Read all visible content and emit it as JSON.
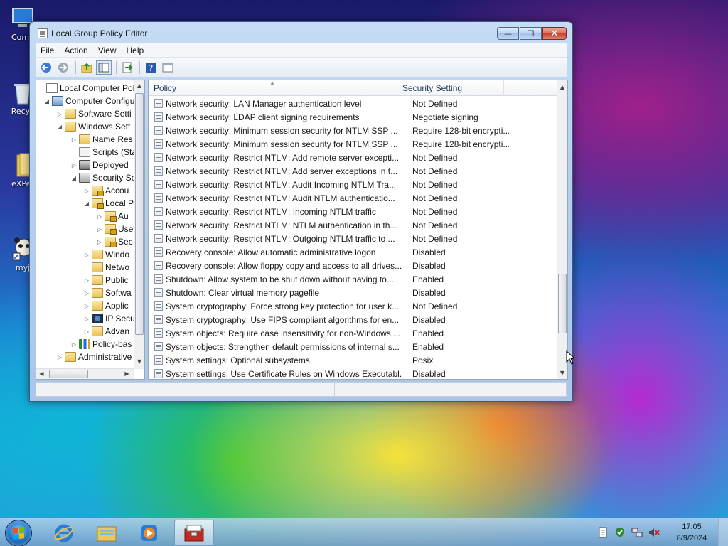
{
  "desktop": {
    "icons": [
      {
        "label": "Comp"
      },
      {
        "label": "Recyc"
      },
      {
        "label": "eXPer"
      },
      {
        "label": "myj"
      }
    ]
  },
  "window": {
    "title": "Local Group Policy Editor",
    "caption_buttons": {
      "minimize": "—",
      "maximize": "❐",
      "close": "✕"
    },
    "menu": [
      {
        "label": "File"
      },
      {
        "label": "Action"
      },
      {
        "label": "View"
      },
      {
        "label": "Help"
      }
    ],
    "toolbar": [
      "back-icon",
      "forward-icon",
      "up-folder-icon",
      "show-hide-tree-icon",
      "export-list-icon",
      "help-icon",
      "properties-icon"
    ],
    "tree": [
      {
        "label": "Local Computer Polic",
        "exp": "",
        "icon": "policy"
      },
      {
        "label": "Computer Configu",
        "exp": "◢",
        "icon": "computer"
      },
      {
        "label": "Software Setti",
        "exp": "▷",
        "icon": "folder"
      },
      {
        "label": "Windows Sett",
        "exp": "◢",
        "icon": "folder"
      },
      {
        "label": "Name Res",
        "exp": "▷",
        "icon": "folder"
      },
      {
        "label": "Scripts (Sta",
        "exp": "",
        "icon": "scripts"
      },
      {
        "label": "Deployed",
        "exp": "▷",
        "icon": "printer"
      },
      {
        "label": "Security Se",
        "exp": "◢",
        "icon": "security"
      },
      {
        "label": "Accou",
        "exp": "▷",
        "icon": "lockfolder"
      },
      {
        "label": "Local P",
        "exp": "◢",
        "icon": "lockfolder"
      },
      {
        "label": "Au",
        "exp": "▷",
        "icon": "lockfolder"
      },
      {
        "label": "Use",
        "exp": "▷",
        "icon": "lockfolder"
      },
      {
        "label": "Sec",
        "exp": "▷",
        "icon": "lockfolder"
      },
      {
        "label": "Windo",
        "exp": "▷",
        "icon": "folder"
      },
      {
        "label": "Netwo",
        "exp": "",
        "icon": "folder"
      },
      {
        "label": "Public",
        "exp": "▷",
        "icon": "folder"
      },
      {
        "label": "Softwa",
        "exp": "▷",
        "icon": "folder"
      },
      {
        "label": "Applic",
        "exp": "▷",
        "icon": "folder"
      },
      {
        "label": "IP Secu",
        "exp": "▷",
        "icon": "ipsec"
      },
      {
        "label": "Advan",
        "exp": "▷",
        "icon": "folder"
      },
      {
        "label": "Policy-bas",
        "exp": "▷",
        "icon": "chart"
      },
      {
        "label": "Administrative",
        "exp": "▷",
        "icon": "folder"
      }
    ],
    "list": {
      "columns": [
        "Policy",
        "Security Setting"
      ],
      "rows": [
        {
          "policy": "Network security: LAN Manager authentication level",
          "setting": "Not Defined"
        },
        {
          "policy": "Network security: LDAP client signing requirements",
          "setting": "Negotiate signing"
        },
        {
          "policy": "Network security: Minimum session security for NTLM SSP ...",
          "setting": "Require 128-bit encrypti..."
        },
        {
          "policy": "Network security: Minimum session security for NTLM SSP ...",
          "setting": "Require 128-bit encrypti..."
        },
        {
          "policy": "Network security: Restrict NTLM: Add remote server excepti...",
          "setting": "Not Defined"
        },
        {
          "policy": "Network security: Restrict NTLM: Add server exceptions in t...",
          "setting": "Not Defined"
        },
        {
          "policy": "Network security: Restrict NTLM: Audit Incoming NTLM Tra...",
          "setting": "Not Defined"
        },
        {
          "policy": "Network security: Restrict NTLM: Audit NTLM authenticatio...",
          "setting": "Not Defined"
        },
        {
          "policy": "Network security: Restrict NTLM: Incoming NTLM traffic",
          "setting": "Not Defined"
        },
        {
          "policy": "Network security: Restrict NTLM: NTLM authentication in th...",
          "setting": "Not Defined"
        },
        {
          "policy": "Network security: Restrict NTLM: Outgoing NTLM traffic to ...",
          "setting": "Not Defined"
        },
        {
          "policy": "Recovery console: Allow automatic administrative logon",
          "setting": "Disabled"
        },
        {
          "policy": "Recovery console: Allow floppy copy and access to all drives...",
          "setting": "Disabled"
        },
        {
          "policy": "Shutdown: Allow system to be shut down without having to...",
          "setting": "Enabled"
        },
        {
          "policy": "Shutdown: Clear virtual memory pagefile",
          "setting": "Disabled"
        },
        {
          "policy": "System cryptography: Force strong key protection for user k...",
          "setting": "Not Defined"
        },
        {
          "policy": "System cryptography: Use FIPS compliant algorithms for en...",
          "setting": "Disabled"
        },
        {
          "policy": "System objects: Require case insensitivity for non-Windows ...",
          "setting": "Enabled"
        },
        {
          "policy": "System objects: Strengthen default permissions of internal s...",
          "setting": "Enabled"
        },
        {
          "policy": "System settings: Optional subsystems",
          "setting": "Posix"
        },
        {
          "policy": "System settings: Use Certificate Rules on Windows Executabl...",
          "setting": "Disabled"
        }
      ]
    }
  },
  "taskbar": {
    "pinned": [
      "internet-explorer-icon",
      "explorer-icon",
      "media-player-icon",
      "group-policy-icon"
    ],
    "clock": {
      "time": "17:05",
      "date": "8/9/2024"
    },
    "tray": [
      "action-center-icon",
      "security-icon",
      "network-icon",
      "volume-muted-icon"
    ]
  }
}
